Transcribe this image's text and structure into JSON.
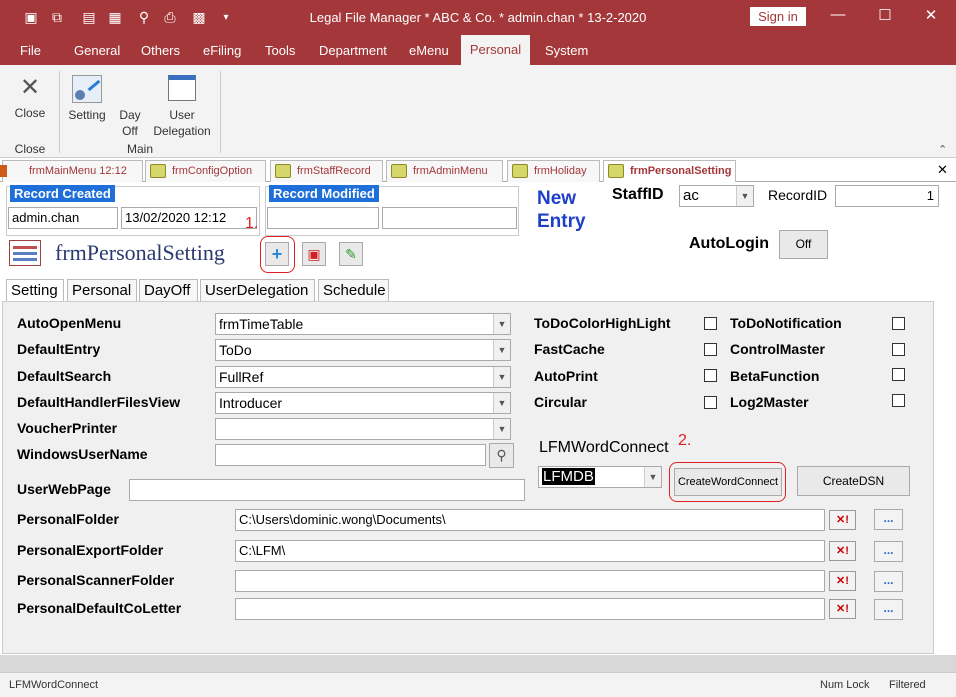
{
  "window": {
    "title": "Legal File Manager * ABC & Co. * admin.chan * 13-2-2020",
    "signin_label": "Sign in",
    "minimize": "—",
    "maximize": "☐",
    "close": "✕"
  },
  "menu": [
    "File",
    "General",
    "Others",
    "eFiling",
    "Tools",
    "Department",
    "eMenu",
    "Personal",
    "System"
  ],
  "ribbon": {
    "close_label": "Close",
    "close_group": "Close",
    "setting_label": "Setting",
    "dayoff_label": "Day\nOff",
    "user_delegation_label": "User\nDelegation",
    "main_group": "Main"
  },
  "doc_tabs": [
    "frmMainMenu 12:12",
    "frmConfigOption",
    "frmStaffRecord",
    "frmAdminMenu",
    "frmHoliday",
    "frmPersonalSetting"
  ],
  "doc_tabs_close": "✕",
  "record": {
    "created_label": "Record Created",
    "created_by": "admin.chan",
    "created_at": "13/02/2020 12:12",
    "modified_label": "Record Modified",
    "modified_by": "",
    "modified_at": "",
    "new_entry": "New\nEntry",
    "staffid_label": "StaffID",
    "staffid_value": "ac",
    "recordid_label": "RecordID",
    "recordid_value": "1",
    "autologin_label": "AutoLogin",
    "autologin_btn": "Off"
  },
  "form_title": "frmPersonalSetting",
  "annotations": {
    "one": "1.",
    "two": "2."
  },
  "sub_tabs": [
    "Setting",
    "Personal",
    "DayOff",
    "UserDelegation",
    "Schedule"
  ],
  "fields": {
    "auto_open_menu": {
      "label": "AutoOpenMenu",
      "value": "frmTimeTable"
    },
    "default_entry": {
      "label": "DefaultEntry",
      "value": "ToDo"
    },
    "default_search": {
      "label": "DefaultSearch",
      "value": "FullRef"
    },
    "default_handler": {
      "label": "DefaultHandlerFilesView",
      "value": "Introducer"
    },
    "voucher_printer": {
      "label": "VoucherPrinter",
      "value": ""
    },
    "windows_user": {
      "label": "WindowsUserName",
      "value": ""
    },
    "user_web_page": {
      "label": "UserWebPage",
      "value": ""
    },
    "personal_folder": {
      "label": "PersonalFolder",
      "value": "C:\\Users\\dominic.wong\\Documents\\"
    },
    "personal_export": {
      "label": "PersonalExportFolder",
      "value": "C:\\LFM\\"
    },
    "personal_scanner": {
      "label": "PersonalScannerFolder",
      "value": ""
    },
    "personal_coletter": {
      "label": "PersonalDefaultCoLetter",
      "value": ""
    }
  },
  "checks": {
    "todo_color": "ToDoColorHighLight",
    "fast_cache": "FastCache",
    "auto_print": "AutoPrint",
    "circular": "Circular",
    "todo_notification": "ToDoNotification",
    "control_master": "ControlMaster",
    "beta_function": "BetaFunction",
    "log2master": "Log2Master"
  },
  "wordconnect": {
    "label": "LFMWordConnect",
    "value": "LFMDB",
    "create_btn": "CreateWordConnect",
    "dsn_btn": "CreateDSN"
  },
  "clear_btn": "✕!",
  "browse_btn": "...",
  "status": {
    "left": "LFMWordConnect",
    "numlock": "Num Lock",
    "filtered": "Filtered"
  }
}
